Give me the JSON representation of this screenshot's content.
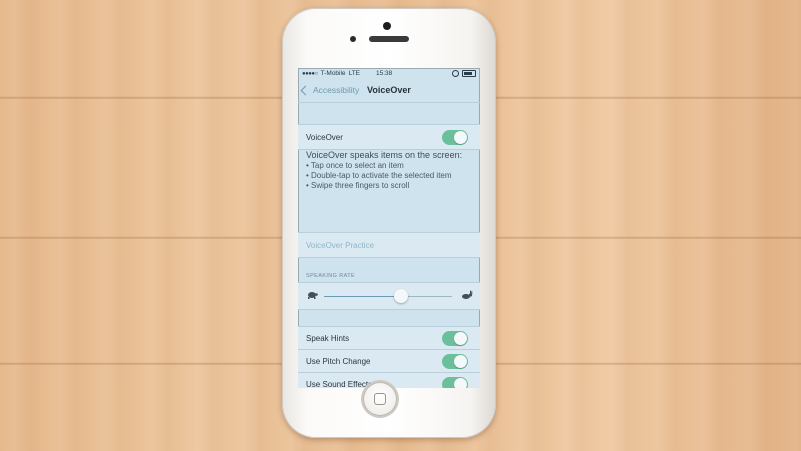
{
  "status_bar": {
    "signal": "●●●●○",
    "carrier": "T-Mobile",
    "network": "LTE",
    "time": "15:38"
  },
  "nav": {
    "back_label": "Accessibility",
    "title": "VoiceOver"
  },
  "voiceover_row": {
    "label": "VoiceOver",
    "enabled": true
  },
  "description": {
    "title": "VoiceOver speaks items on the screen:",
    "bullets": [
      "• Tap once to select an item",
      "• Double-tap to activate the selected item",
      "• Swipe three fingers to scroll"
    ]
  },
  "practice": {
    "label": "VoiceOver Practice"
  },
  "speaking_rate": {
    "header": "SPEAKING RATE",
    "value": 0.6
  },
  "toggles": [
    {
      "label": "Speak Hints",
      "enabled": true
    },
    {
      "label": "Use Pitch Change",
      "enabled": true
    },
    {
      "label": "Use Sound Effects",
      "enabled": true
    }
  ],
  "colors": {
    "toggle_on": "#6bbf9c",
    "accent": "#6b9ab2",
    "screen_bg": "#cfe3ee"
  }
}
